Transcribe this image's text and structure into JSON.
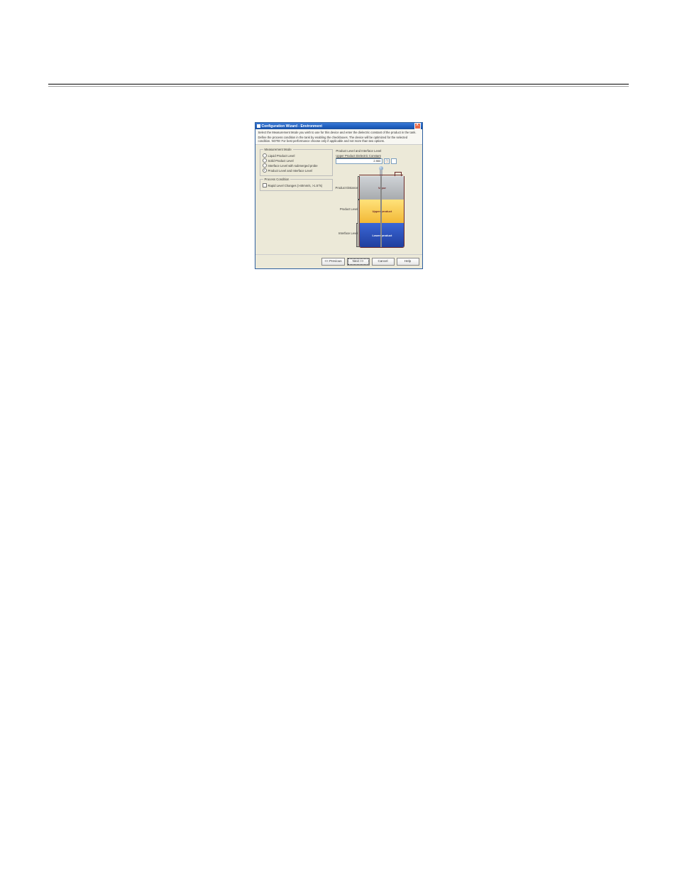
{
  "titlebar": {
    "title": "Configuration Wizard - Environment",
    "close": "X"
  },
  "intro": {
    "line1": "Select the Measurement Mode you wish to use for this device and enter the dielectric constant of the product in the tank.",
    "line2": "Define the process condition in the tank by enabling the checkboxes. The device will be optimized for the selected condition. NOTE! For best performance choose only if applicable and not more than two options."
  },
  "mode_group": {
    "title": "Measurement Mode",
    "opts": [
      "Liquid Product Level",
      "Solid Product Level",
      "Interface Level with submerged probe",
      "Product Level and Interface Level"
    ],
    "selected": 3
  },
  "cond_group": {
    "title": "Process Condition",
    "opt": "Rapid Level Changes (>40mm/s, >1.5\"/s)"
  },
  "right": {
    "title": "Product Level and Interface Level",
    "field_label": "Upper Product Dielectric Constant",
    "value": "2.900",
    "clipboard": "📋",
    "labels": {
      "pd": "Product Distance",
      "pl": "Product Level",
      "il": "Interface Level"
    },
    "layers": {
      "vapor": "Vapor",
      "upper": "Upper product",
      "lower": "Lower product"
    }
  },
  "buttons": {
    "prev": "<< Previous",
    "next": "Next >>",
    "cancel": "Cancel",
    "help": "Help"
  }
}
